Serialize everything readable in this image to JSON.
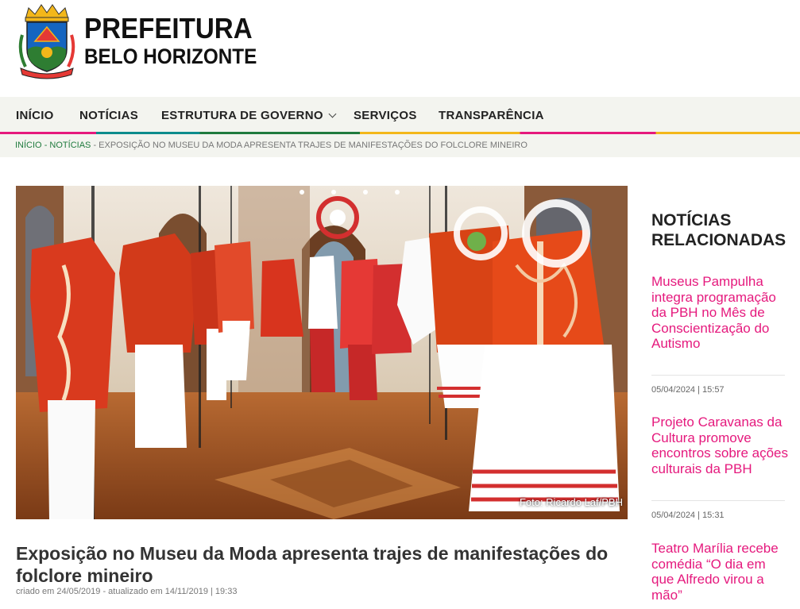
{
  "header": {
    "logo_line1": "PREFEITURA",
    "logo_line2": "BELO HORIZONTE"
  },
  "nav": {
    "items": [
      "INÍCIO",
      "NOTÍCIAS",
      "ESTRUTURA DE GOVERNO",
      "SERVIÇOS",
      "TRANSPARÊNCIA"
    ]
  },
  "breadcrumb": {
    "home": "INÍCIO",
    "section": "NOTÍCIAS",
    "current": "EXPOSIÇÃO NO MUSEU DA MODA APRESENTA TRAJES DE MANIFESTAÇÕES DO FOLCLORE MINEIRO"
  },
  "article": {
    "photo_credit": "Foto: Ricardo Laf/PBH",
    "title": "Exposição no Museu da Moda apresenta trajes de manifestações do folclore mineiro",
    "meta": "criado em 24/05/2019 - atualizado em 14/11/2019 | 19:33"
  },
  "sidebar": {
    "heading": "NOTÍCIAS RELACIONADAS",
    "news": [
      {
        "title": "Museus Pampulha integra programação da PBH no Mês de Conscientização do Autismo",
        "date": "05/04/2024 | 15:57"
      },
      {
        "title": "Projeto Caravanas da Cultura promove encontros sobre ações culturais da PBH",
        "date": "05/04/2024 | 15:31"
      },
      {
        "title": "Teatro Marília recebe comédia “O dia em que Alfredo virou a mão”",
        "date": ""
      }
    ]
  },
  "colors": {
    "accent": "#e5197d",
    "breadcrumb_link": "#1f7a3d",
    "nav_bg": "#f3f4ef"
  }
}
